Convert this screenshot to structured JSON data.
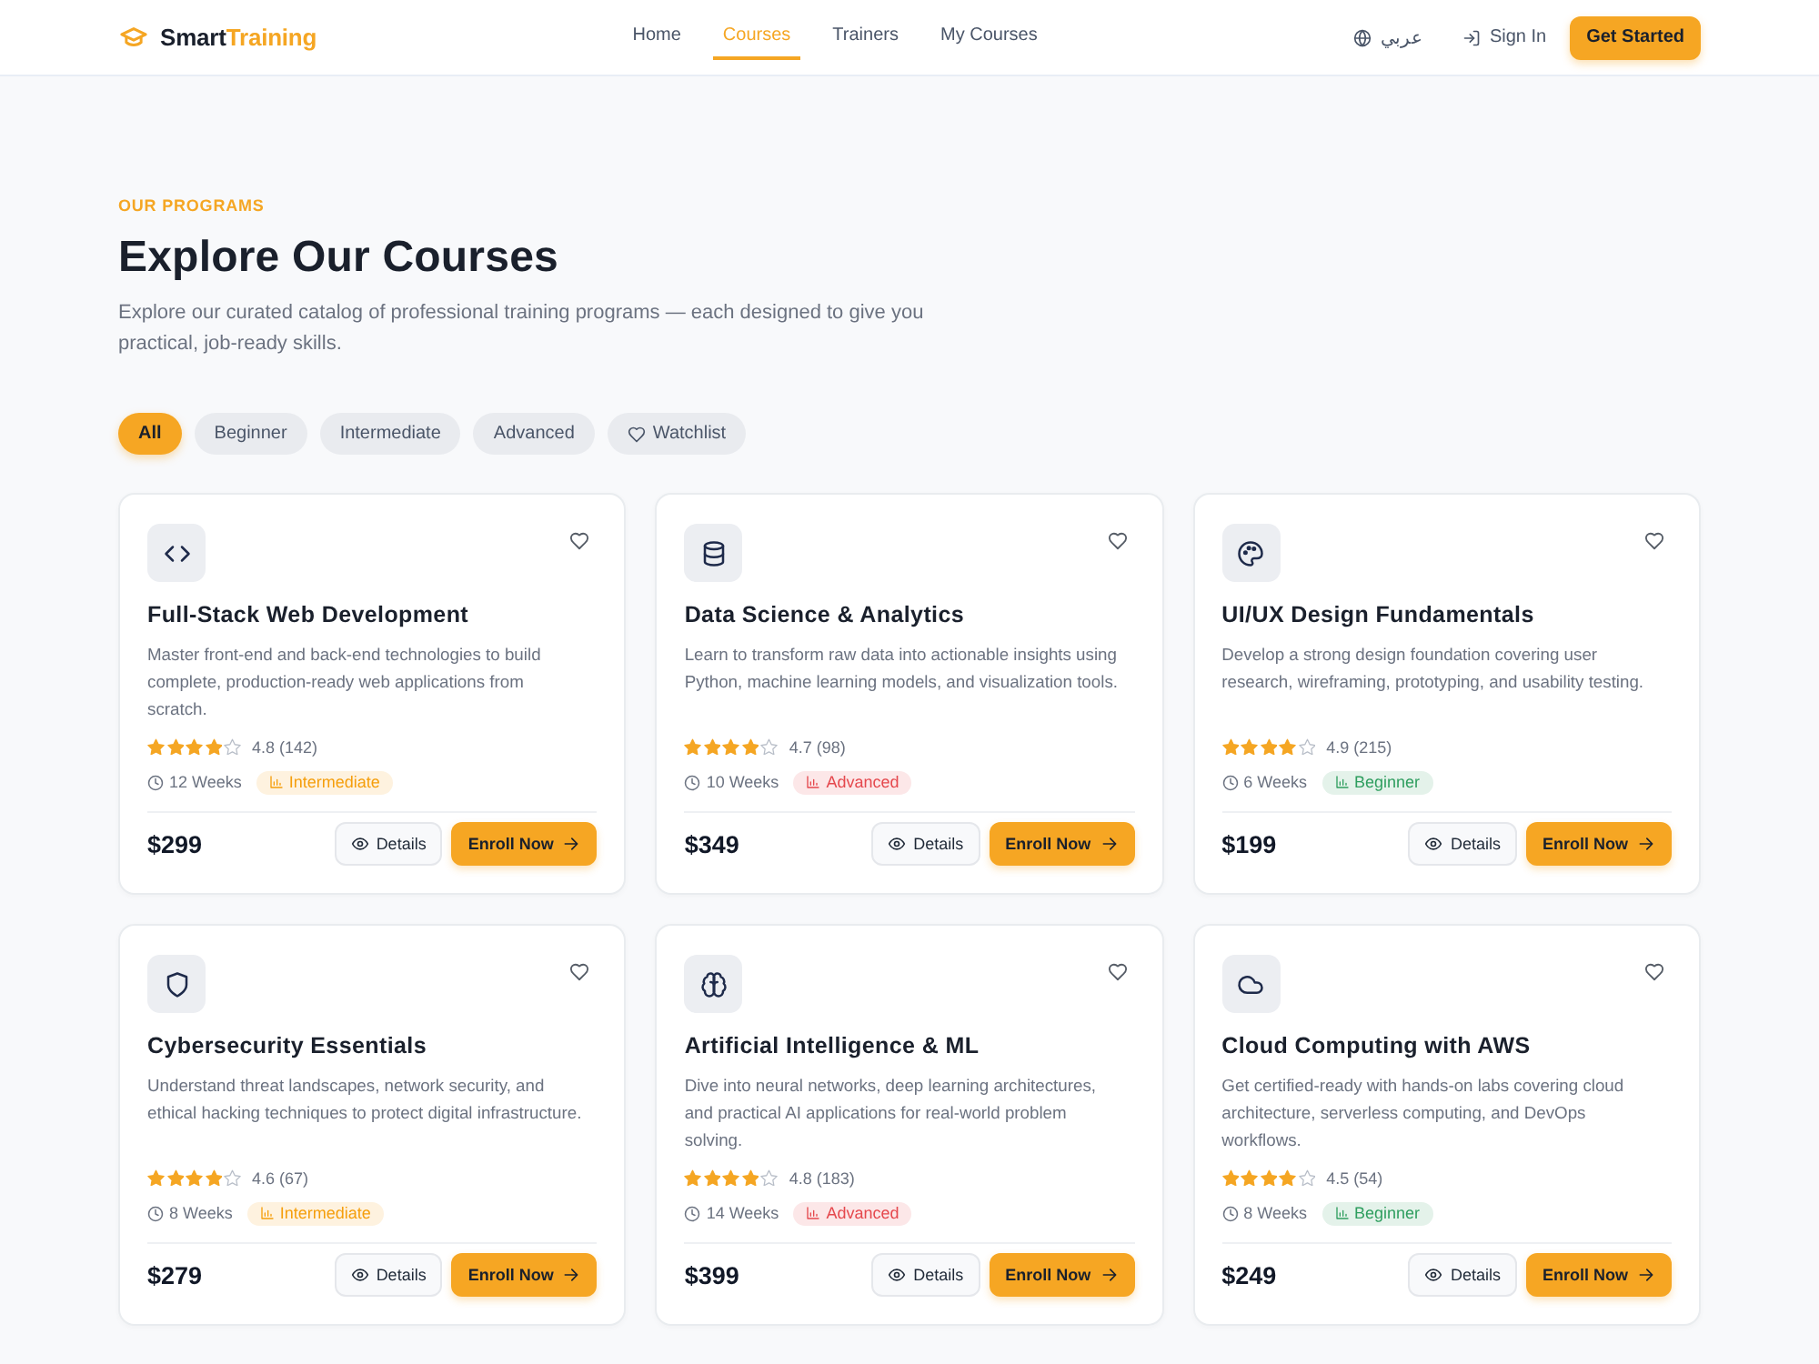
{
  "header": {
    "brand": {
      "primary": "Smart",
      "accent": "Training"
    },
    "nav": [
      {
        "label": "Home",
        "selected": false
      },
      {
        "label": "Courses",
        "selected": true
      },
      {
        "label": "Trainers",
        "selected": false
      },
      {
        "label": "My Courses",
        "selected": false
      }
    ],
    "language": "عربي",
    "sign_in": "Sign In",
    "cta": "Get Started"
  },
  "hero": {
    "eyebrow": "OUR PROGRAMS",
    "title": "Explore Our Courses",
    "description": "Explore our curated catalog of professional training programs — each designed to give you practical, job-ready skills."
  },
  "filters": [
    {
      "label": "All",
      "kind": "level",
      "selected": true
    },
    {
      "label": "Beginner",
      "kind": "level",
      "selected": false
    },
    {
      "label": "Intermediate",
      "kind": "level",
      "selected": false
    },
    {
      "label": "Advanced",
      "kind": "level",
      "selected": false
    },
    {
      "label": "Watchlist",
      "kind": "watchlist",
      "selected": false
    }
  ],
  "courses": [
    {
      "kind": "web",
      "title": "Full-Stack Web Development",
      "description": "Master front-end and back-end technologies to build complete, production-ready web applications from scratch.",
      "saved": false,
      "stars": 4,
      "rating": "4.8 (142)",
      "duration": "12 Weeks",
      "badge": {
        "label": "Intermediate",
        "color": "#f59e0b"
      },
      "price": "$299",
      "details": "Details",
      "enroll": "Enroll Now"
    },
    {
      "kind": "data",
      "title": "Data Science & Analytics",
      "description": "Learn to transform raw data into actionable insights using Python, machine learning models, and visualization tools.",
      "saved": false,
      "stars": 4,
      "rating": "4.7 (98)",
      "duration": "10 Weeks",
      "badge": {
        "label": "Advanced",
        "color": "#e5484d"
      },
      "price": "$349",
      "details": "Details",
      "enroll": "Enroll Now"
    },
    {
      "kind": "design",
      "title": "UI/UX Design Fundamentals",
      "description": "Develop a strong design foundation covering user research, wireframing, prototyping, and usability testing.",
      "saved": false,
      "stars": 4,
      "rating": "4.9 (215)",
      "duration": "6 Weeks",
      "badge": {
        "label": "Beginner",
        "color": "#2f9e5f"
      },
      "price": "$199",
      "details": "Details",
      "enroll": "Enroll Now"
    },
    {
      "kind": "security",
      "title": "Cybersecurity Essentials",
      "description": "Understand threat landscapes, network security, and ethical hacking techniques to protect digital infrastructure.",
      "saved": false,
      "stars": 4,
      "rating": "4.6 (67)",
      "duration": "8 Weeks",
      "badge": {
        "label": "Intermediate",
        "color": "#f59e0b"
      },
      "price": "$279",
      "details": "Details",
      "enroll": "Enroll Now"
    },
    {
      "kind": "ai",
      "title": "Artificial Intelligence & ML",
      "description": "Dive into neural networks, deep learning architectures, and practical AI applications for real-world problem solving.",
      "saved": false,
      "stars": 4,
      "rating": "4.8 (183)",
      "duration": "14 Weeks",
      "badge": {
        "label": "Advanced",
        "color": "#e5484d"
      },
      "price": "$399",
      "details": "Details",
      "enroll": "Enroll Now"
    },
    {
      "kind": "cloud",
      "title": "Cloud Computing with AWS",
      "description": "Get certified-ready with hands-on labs covering cloud architecture, serverless computing, and DevOps workflows.",
      "saved": false,
      "stars": 4,
      "rating": "4.5 (54)",
      "duration": "8 Weeks",
      "badge": {
        "label": "Beginner",
        "color": "#2f9e5f"
      },
      "price": "$249",
      "details": "Details",
      "enroll": "Enroll Now"
    }
  ]
}
